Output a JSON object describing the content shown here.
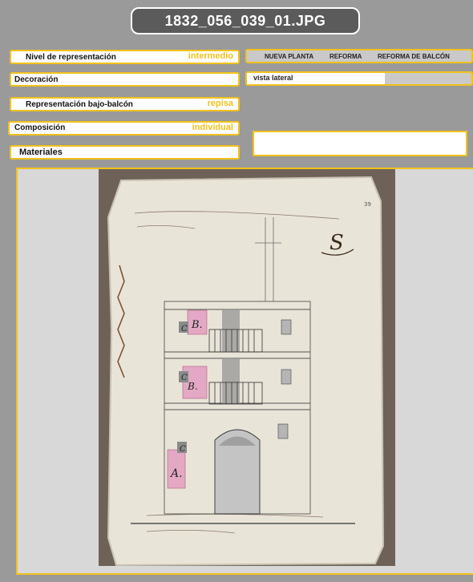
{
  "title": "1832_056_039_01.JPG",
  "fields": {
    "nivel": {
      "label": "Nivel de representación",
      "value": "intermedio"
    },
    "decoracion": {
      "label": "Decoración",
      "value": ""
    },
    "bajo_balcon": {
      "label": "Representación bajo-balcón",
      "value": "repisa"
    },
    "composicion": {
      "label": "Composición",
      "value": "individual"
    },
    "materiales": {
      "label": "Materiales",
      "value": ""
    }
  },
  "tabs": [
    "NUEVA PLANTA",
    "REFORMA",
    "REFORMA DE  BALCÓN"
  ],
  "vista": {
    "label": "vista lateral"
  },
  "colors": {
    "accent": "#f2c21b",
    "background": "#9a9a9a",
    "title_bg": "#5b5b5b"
  },
  "drawing": {
    "page_number": "39",
    "sheet_signature": "S",
    "room_labels": [
      "C",
      "B.",
      "C",
      "B.",
      "C",
      "A."
    ]
  }
}
